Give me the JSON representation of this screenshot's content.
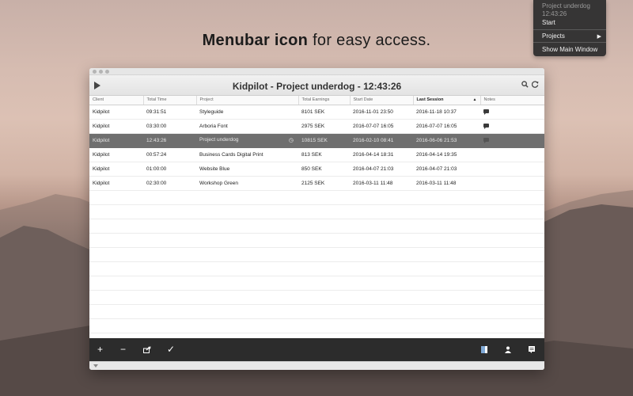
{
  "headline": {
    "bold": "Menubar icon",
    "rest": " for easy access."
  },
  "menu": {
    "project_name": "Project underdog",
    "elapsed": "12:43:26",
    "start_label": "Start",
    "projects_label": "Projects",
    "submenu_arrow": "▶",
    "show_main_label": "Show Main Window"
  },
  "window": {
    "title": "Kidpilot - Project underdog - 12:43:26",
    "toolbar_icons": [
      "play-icon",
      "search-icon",
      "refresh-icon"
    ]
  },
  "table": {
    "headers": [
      "Client",
      "Total Time",
      "Project",
      "Total Earnings",
      "Start Date",
      "Last Session",
      "Notes"
    ],
    "sorted_column": "Last Session",
    "rows": [
      {
        "client": "Kidpilot",
        "time": "09:31:51",
        "project": "Styleguide",
        "earnings": "8101 SEK",
        "start": "2016-11-01 23:50",
        "last": "2016-11-18 10:37",
        "has_note": true
      },
      {
        "client": "Kidpilot",
        "time": "03:30:00",
        "project": "Arboria Font",
        "earnings": "2975 SEK",
        "start": "2016-07-07 16:05",
        "last": "2016-07-07 16:05",
        "has_note": true
      },
      {
        "client": "Kidpilot",
        "time": "12:43:26",
        "project": "Project underdog",
        "earnings": "10815 SEK",
        "start": "2016-02-10 08:41",
        "last": "2016-06-06 21:53",
        "has_note": true
      },
      {
        "client": "Kidpilot",
        "time": "00:57:24",
        "project": "Business Cards Digital Print",
        "earnings": "813 SEK",
        "start": "2016-04-14 18:31",
        "last": "2016-04-14 19:35",
        "has_note": false
      },
      {
        "client": "Kidpilot",
        "time": "01:00:00",
        "project": "Website Blue",
        "earnings": "850 SEK",
        "start": "2016-04-07 21:03",
        "last": "2016-04-07 21:03",
        "has_note": false
      },
      {
        "client": "Kidpilot",
        "time": "02:30:00",
        "project": "Workshop Green",
        "earnings": "2125 SEK",
        "start": "2016-03-11 11:48",
        "last": "2016-03-11 11:48",
        "has_note": false
      }
    ],
    "selected_index": 2
  },
  "bottombar": {
    "add": "+",
    "remove": "−",
    "export": "⇪",
    "check": "✓",
    "right_icons": [
      "sidebar-icon",
      "client-icon",
      "notes-icon"
    ]
  },
  "colors": {
    "selection": "#6f6f6f",
    "bottombar": "#2c2c2c",
    "menu_bg": "#303030"
  }
}
